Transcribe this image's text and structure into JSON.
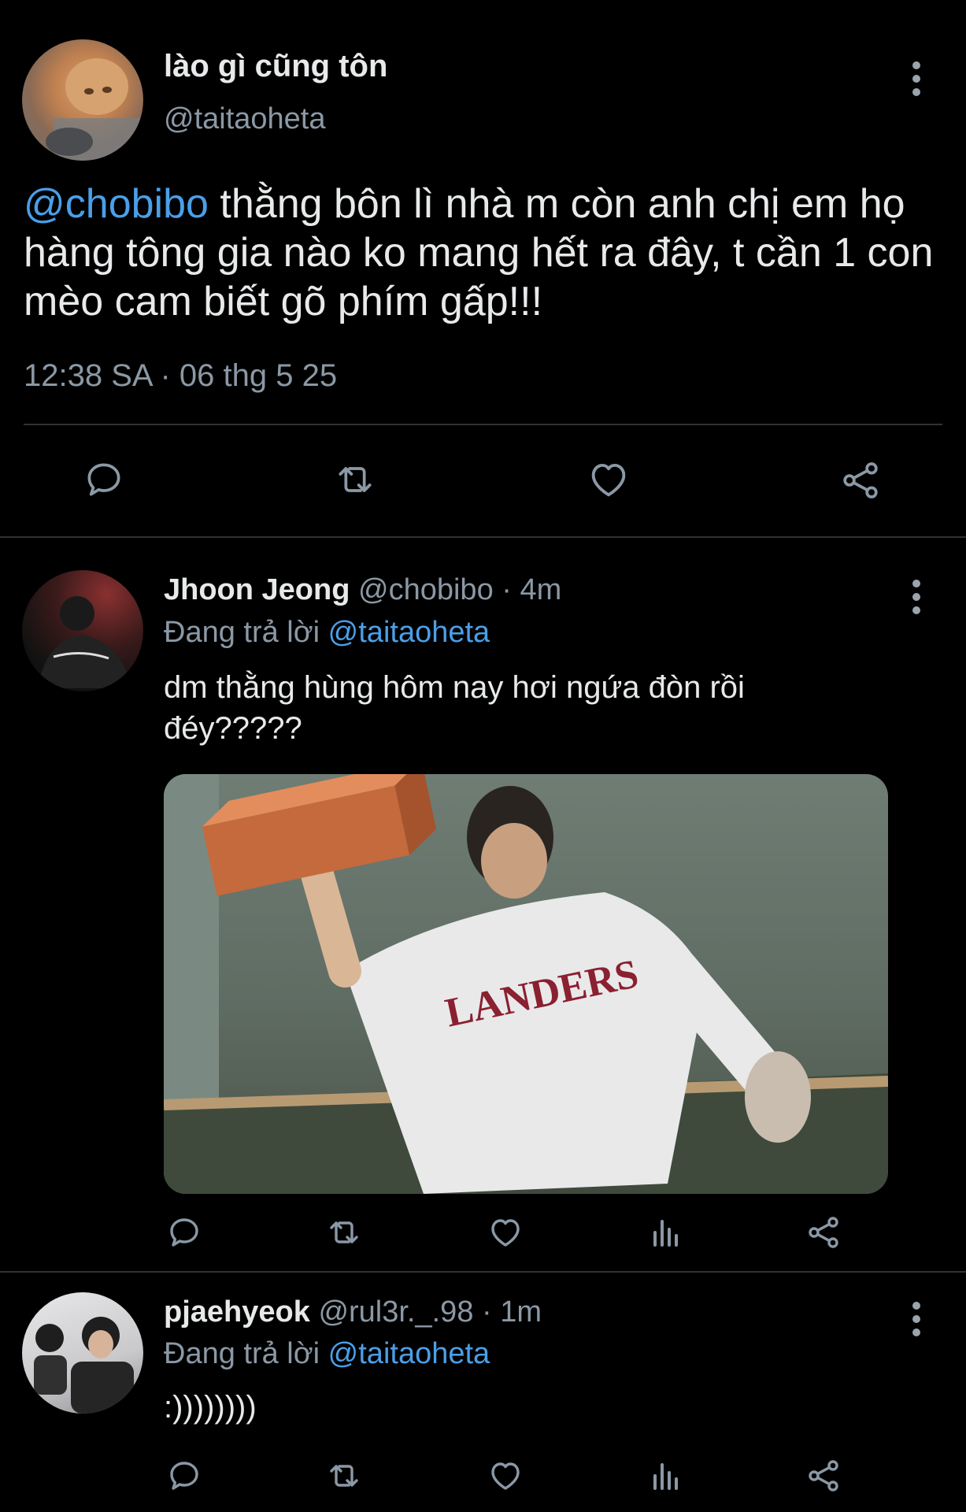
{
  "main_tweet": {
    "display_name": "lào gì cũng tôn",
    "handle": "@taitaoheta",
    "mention": "@chobibo",
    "text": " thằng bôn lì nhà m còn anh chị em họ hàng tông gia nào ko mang hết ra đây, t cần 1 con mèo cam biết gõ phím gấp!!!",
    "timestamp": "12:38 SA · 06 thg 5 25"
  },
  "replies": [
    {
      "display_name": "Jhoon Jeong",
      "meta": "@chobibo · 4m",
      "replying_prefix": "Đang trả lời",
      "replying_to": "@taitaoheta",
      "text": "dm thằng hùng hôm nay hơi ngứa đòn rồi đéy?????"
    },
    {
      "display_name": "pjaehyeok",
      "meta": "@rul3r._.98 · 1m",
      "replying_prefix": "Đang trả lời",
      "replying_to": "@taitaoheta",
      "text": ":))))))))"
    }
  ],
  "colors": {
    "background": "#000000",
    "text": "#e7e9ea",
    "muted": "#8b98a5",
    "link": "#4a9fe8",
    "divider": "#2f3336"
  },
  "icons": [
    "more-icon",
    "reply-icon",
    "retweet-icon",
    "like-icon",
    "share-icon",
    "views-icon"
  ]
}
